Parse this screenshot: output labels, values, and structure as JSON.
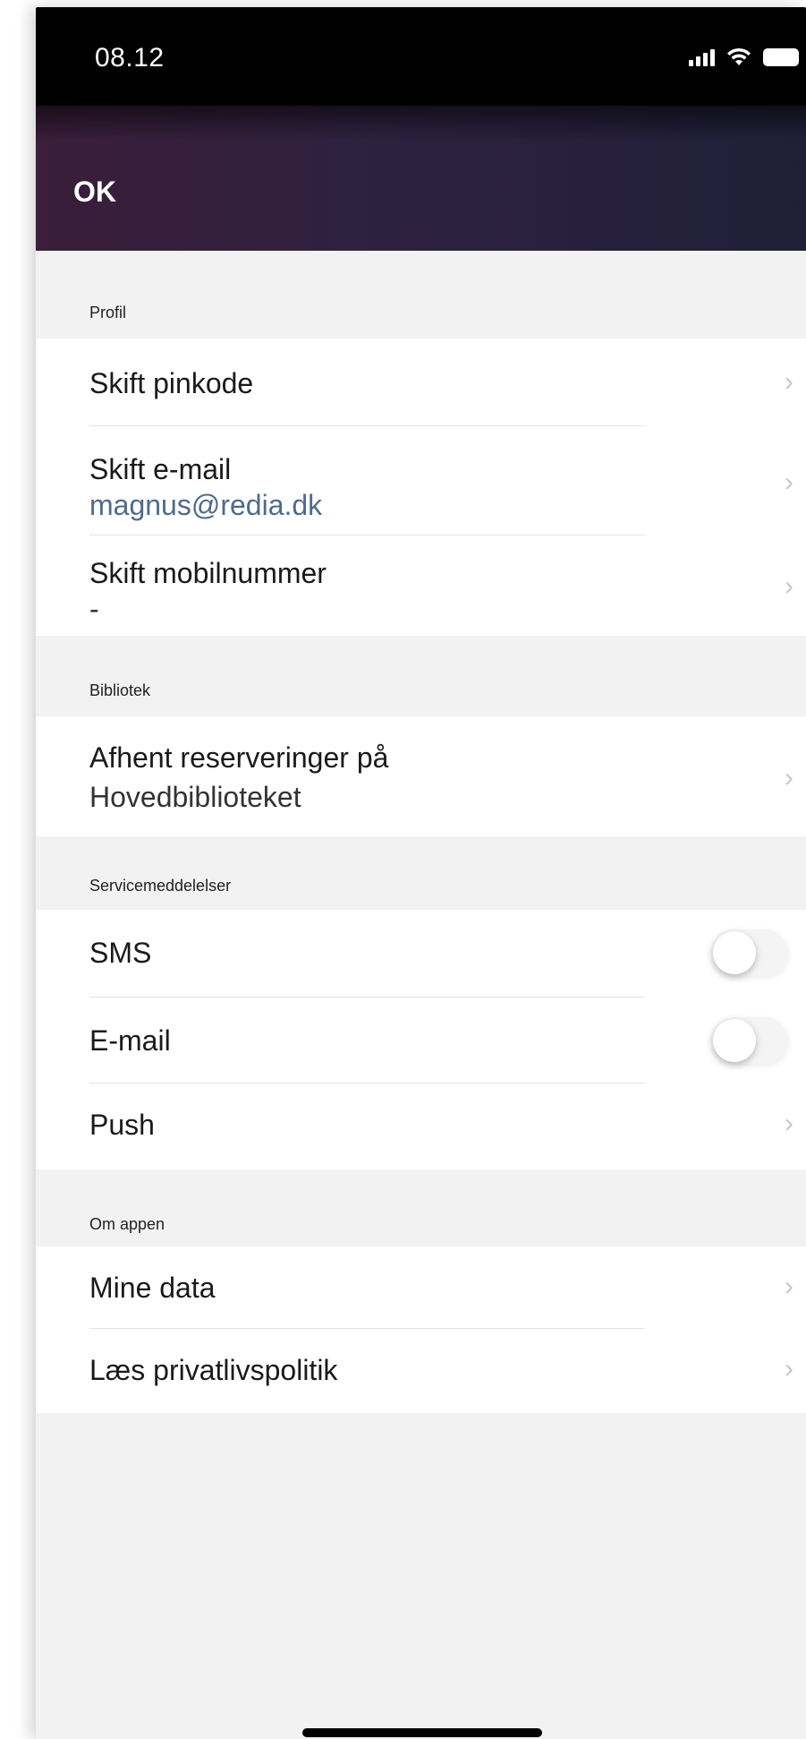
{
  "status_bar": {
    "time": "08.12"
  },
  "nav": {
    "ok_label": "OK"
  },
  "sections": {
    "profil": {
      "header": "Profil",
      "change_pin": "Skift pinkode",
      "change_email": "Skift e-mail",
      "email_value": "magnus@redia.dk",
      "change_phone": "Skift mobilnummer",
      "phone_value": "-"
    },
    "bibliotek": {
      "header": "Bibliotek",
      "pickup_label": "Afhent reserveringer på",
      "pickup_value": "Hovedbiblioteket"
    },
    "service": {
      "header": "Servicemeddelelser",
      "sms": "SMS",
      "email": "E-mail",
      "push": "Push"
    },
    "about": {
      "header": "Om appen",
      "my_data": "Mine data",
      "privacy": "Læs privatlivspolitik"
    }
  },
  "toggles": {
    "sms_on": false,
    "email_on": false
  },
  "colors": {
    "nav_gradient_start": "#3a1e3a",
    "nav_gradient_end": "#1f2038",
    "value_text": "#4f6b8c",
    "section_bg": "#f2f2f2"
  },
  "icons": {
    "chevron": "chevron-right-icon",
    "signal": "signal-icon",
    "wifi": "wifi-icon",
    "battery": "battery-icon"
  }
}
